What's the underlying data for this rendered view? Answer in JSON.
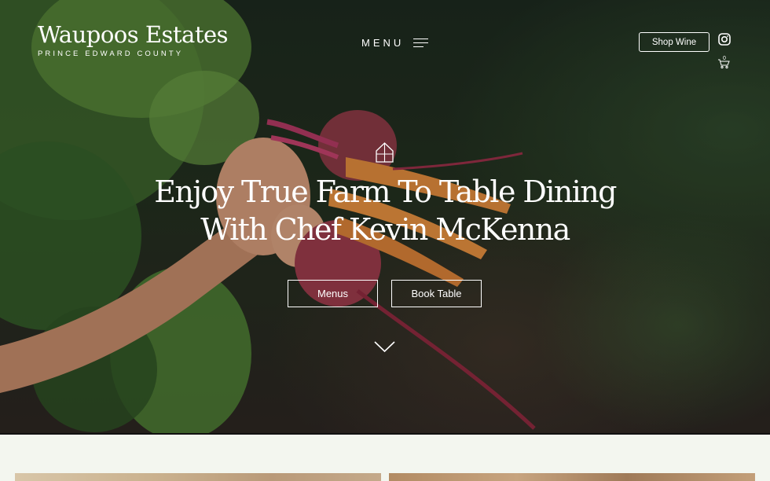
{
  "brand": {
    "name": "Waupoos Estates",
    "subtitle": "PRINCE EDWARD COUNTY"
  },
  "nav": {
    "menu_label": "MENU",
    "shop_label": "Shop Wine",
    "cart_count": "0"
  },
  "hero": {
    "headline_line1": "Enjoy True Farm To Table Dining",
    "headline_line2": "With Chef Kevin McKenna",
    "menus_button": "Menus",
    "book_button": "Book Table"
  },
  "colors": {
    "text": "#ffffff",
    "page_background": "#f3f6ef",
    "divider": "#111111"
  },
  "icons": [
    "hamburger-icon",
    "instagram-icon",
    "cart-icon",
    "barn-icon",
    "chevron-down-icon"
  ]
}
